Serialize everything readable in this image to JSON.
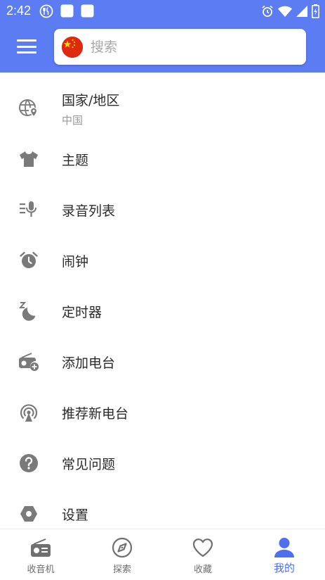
{
  "status_bar": {
    "time": "2:42",
    "left_icons": [
      "restaurant-icon",
      "notification-square-icon",
      "notification-square-icon"
    ],
    "right_icons": [
      "alarm-icon",
      "wifi-icon",
      "signal-icon",
      "battery-charging-icon"
    ]
  },
  "header": {
    "background": "#5b7cf2",
    "menu_icon": "hamburger-icon",
    "flag_icon": "china-flag-icon",
    "search_placeholder": "搜索"
  },
  "menu": {
    "items": [
      {
        "icon": "globe-location-icon",
        "label": "国家/地区",
        "sublabel": "中国"
      },
      {
        "icon": "tshirt-icon",
        "label": "主题"
      },
      {
        "icon": "recording-list-icon",
        "label": "录音列表"
      },
      {
        "icon": "alarm-clock-icon",
        "label": "闹钟"
      },
      {
        "icon": "sleep-timer-icon",
        "label": "定时器"
      },
      {
        "icon": "add-radio-icon",
        "label": "添加电台"
      },
      {
        "icon": "broadcast-icon",
        "label": "推荐新电台"
      },
      {
        "icon": "help-icon",
        "label": "常见问题"
      },
      {
        "icon": "settings-hexagon-icon",
        "label": "设置"
      }
    ]
  },
  "bottom_nav": {
    "items": [
      {
        "icon": "radio-icon",
        "label": "收音机"
      },
      {
        "icon": "compass-icon",
        "label": "探索"
      },
      {
        "icon": "heart-icon",
        "label": "收藏"
      },
      {
        "icon": "person-icon",
        "label": "我的"
      }
    ],
    "active_index": 3,
    "active_color": "#4f6ef0",
    "inactive_color": "#6f6f6f"
  }
}
